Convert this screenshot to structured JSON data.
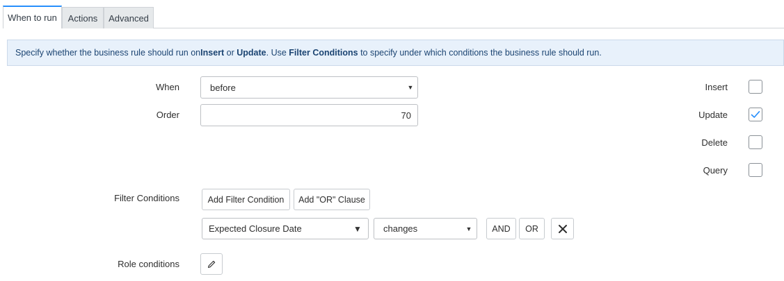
{
  "tabs": [
    {
      "label": "When to run",
      "active": true
    },
    {
      "label": "Actions",
      "active": false
    },
    {
      "label": "Advanced",
      "active": false
    }
  ],
  "info": {
    "t1": "Specify whether the business rule should run on ",
    "b1": "Insert",
    "t2": " or ",
    "b2": "Update",
    "t3": ". Use ",
    "b3": "Filter Conditions",
    "t4": " to specify under which conditions the business rule should run."
  },
  "form": {
    "when_label": "When",
    "when_value": "before",
    "order_label": "Order",
    "order_value": "70",
    "filter_label": "Filter Conditions",
    "role_label": "Role conditions"
  },
  "operations": [
    {
      "label": "Insert",
      "checked": false
    },
    {
      "label": "Update",
      "checked": true
    },
    {
      "label": "Delete",
      "checked": false
    },
    {
      "label": "Query",
      "checked": false
    }
  ],
  "filter": {
    "add_condition_label": "Add Filter Condition",
    "add_or_label": "Add \"OR\" Clause",
    "field_value": "Expected Closure Date",
    "operator_value": "changes",
    "and_label": "AND",
    "or_label": "OR"
  },
  "colors": {
    "accent": "#278efc",
    "info_bg": "#e8f1fb",
    "info_text": "#1b4472"
  }
}
